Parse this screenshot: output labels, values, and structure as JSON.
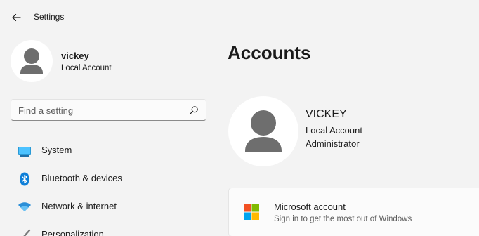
{
  "titlebar": {
    "title": "Settings",
    "back_icon": "back-arrow-icon"
  },
  "profile": {
    "name": "vickey",
    "account_type": "Local Account"
  },
  "search": {
    "placeholder": "Find a setting",
    "icon": "search-icon"
  },
  "nav": {
    "items": [
      {
        "label": "System",
        "icon": "system-display-icon"
      },
      {
        "label": "Bluetooth & devices",
        "icon": "bluetooth-icon"
      },
      {
        "label": "Network & internet",
        "icon": "wifi-icon"
      },
      {
        "label": "Personalization",
        "icon": "paintbrush-icon"
      }
    ]
  },
  "main": {
    "title": "Accounts",
    "account": {
      "name": "VICKEY",
      "type": "Local Account",
      "role": "Administrator"
    },
    "microsoft_card": {
      "title": "Microsoft account",
      "subtitle": "Sign in to get the most out of Windows",
      "icon": "microsoft-logo-icon"
    }
  },
  "colors": {
    "background": "#f3f3f3",
    "accent": "#0067c0",
    "card": "#fbfbfb"
  }
}
